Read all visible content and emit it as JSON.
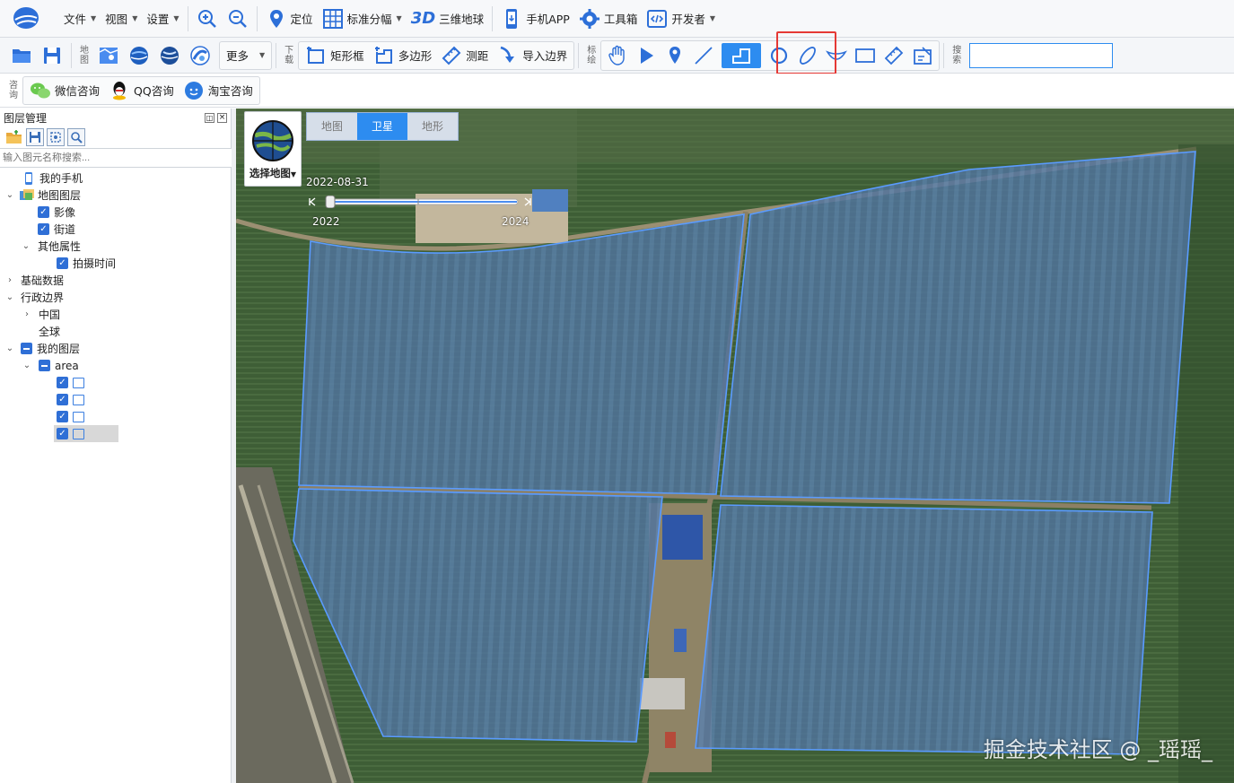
{
  "menubar": {
    "file": "文件",
    "view": "视图",
    "settings": "设置",
    "locate": "定位",
    "standard_sheet": "标准分幅",
    "globe_3d_badge": "3D",
    "globe_3d": "三维地球",
    "mobile_app": "手机APP",
    "toolbox": "工具箱",
    "developer": "开发者"
  },
  "toolbar": {
    "map_group_label": "地图",
    "more": "更多",
    "download_group_label": "下载",
    "rect_frame": "矩形框",
    "polygon": "多边形",
    "measure": "测距",
    "import_boundary": "导入边界",
    "annotate_group_label": "标绘",
    "search_group_label": "搜索",
    "search_value": ""
  },
  "consult": {
    "group_label": "咨询",
    "wechat": "微信咨询",
    "qq": "QQ咨询",
    "taobao": "淘宝咨询"
  },
  "layer_panel": {
    "title": "图层管理",
    "search_placeholder": "输入图元名称搜索...",
    "items": {
      "my_phone": "我的手机",
      "map_layers": "地图图层",
      "imagery": "影像",
      "streets": "街道",
      "other_props": "其他属性",
      "capture_time": "拍摄时间",
      "base_data": "基础数据",
      "admin_boundary": "行政边界",
      "china": "中国",
      "global": "全球",
      "my_layers": "我的图层",
      "area": "area"
    }
  },
  "map": {
    "basemap_label": "选择地图",
    "tabs": [
      "地图",
      "卫星",
      "地形"
    ],
    "active_tab": "卫星",
    "capture_date": "2022-08-31",
    "timeline_start": "2022",
    "timeline_end": "2024",
    "polygon_fill_color": "#4f7fd6",
    "polygon_stroke_color": "#5a9bff"
  },
  "watermark": "掘金技术社区 @ _瑶瑶_",
  "colors": {
    "accent": "#2d8cf0",
    "highlight": "#e53935"
  }
}
